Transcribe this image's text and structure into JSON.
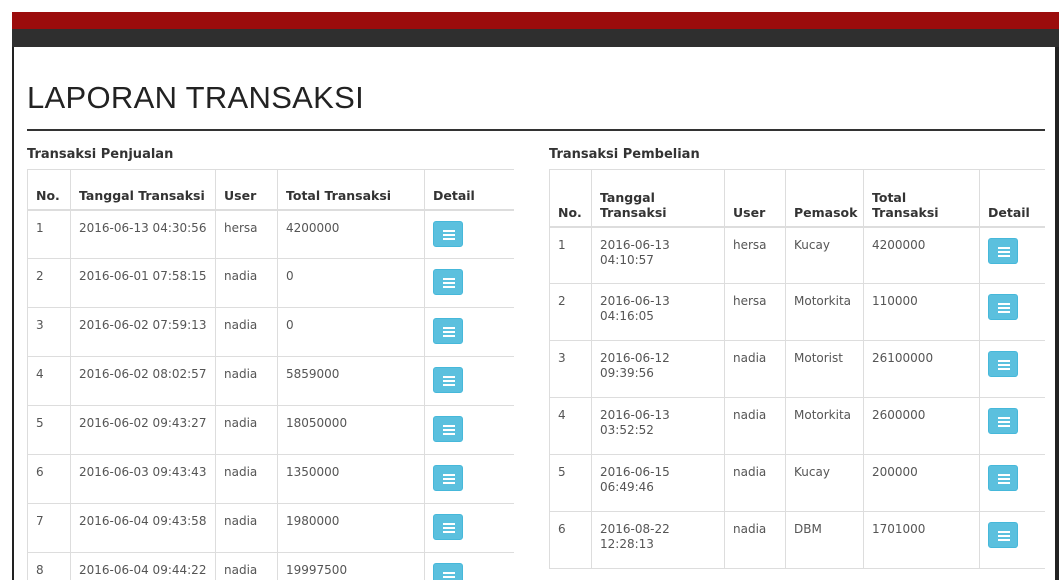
{
  "page_title": "LAPORAN TRANSAKSI",
  "penjualan": {
    "title": "Transaksi Penjualan",
    "headers": [
      "No.",
      "Tanggal Transaksi",
      "User",
      "Total Transaksi",
      "Detail"
    ],
    "rows": [
      {
        "no": "1",
        "tanggal": "2016-06-13 04:30:56",
        "user": "hersa",
        "total": "4200000"
      },
      {
        "no": "2",
        "tanggal": "2016-06-01 07:58:15",
        "user": "nadia",
        "total": "0"
      },
      {
        "no": "3",
        "tanggal": "2016-06-02 07:59:13",
        "user": "nadia",
        "total": "0"
      },
      {
        "no": "4",
        "tanggal": "2016-06-02 08:02:57",
        "user": "nadia",
        "total": "5859000"
      },
      {
        "no": "5",
        "tanggal": "2016-06-02 09:43:27",
        "user": "nadia",
        "total": "18050000"
      },
      {
        "no": "6",
        "tanggal": "2016-06-03 09:43:43",
        "user": "nadia",
        "total": "1350000"
      },
      {
        "no": "7",
        "tanggal": "2016-06-04 09:43:58",
        "user": "nadia",
        "total": "1980000"
      },
      {
        "no": "8",
        "tanggal": "2016-06-04 09:44:22",
        "user": "nadia",
        "total": "19997500"
      }
    ],
    "detail_icon": "list-icon"
  },
  "pembelian": {
    "title": "Transaksi Pembelian",
    "headers": [
      "No.",
      "Tanggal Transaksi",
      "User",
      "Pemasok",
      "Total Transaksi",
      "Detail"
    ],
    "rows": [
      {
        "no": "1",
        "tanggal": "2016-06-13 04:10:57",
        "user": "hersa",
        "pemasok": "Kucay",
        "total": "4200000"
      },
      {
        "no": "2",
        "tanggal": "2016-06-13 04:16:05",
        "user": "hersa",
        "pemasok": "Motorkita",
        "total": "110000"
      },
      {
        "no": "3",
        "tanggal": "2016-06-12 09:39:56",
        "user": "nadia",
        "pemasok": "Motorist",
        "total": "26100000"
      },
      {
        "no": "4",
        "tanggal": "2016-06-13 03:52:52",
        "user": "nadia",
        "pemasok": "Motorkita",
        "total": "2600000"
      },
      {
        "no": "5",
        "tanggal": "2016-06-15 06:49:46",
        "user": "nadia",
        "pemasok": "Kucay",
        "total": "200000"
      },
      {
        "no": "6",
        "tanggal": "2016-08-22 12:28:13",
        "user": "nadia",
        "pemasok": "DBM",
        "total": "1701000"
      }
    ],
    "detail_icon": "list-icon"
  },
  "colors": {
    "header_red": "#9b0c0c",
    "header_dark": "#2f2f2f",
    "detail_button": "#5bc0de"
  }
}
